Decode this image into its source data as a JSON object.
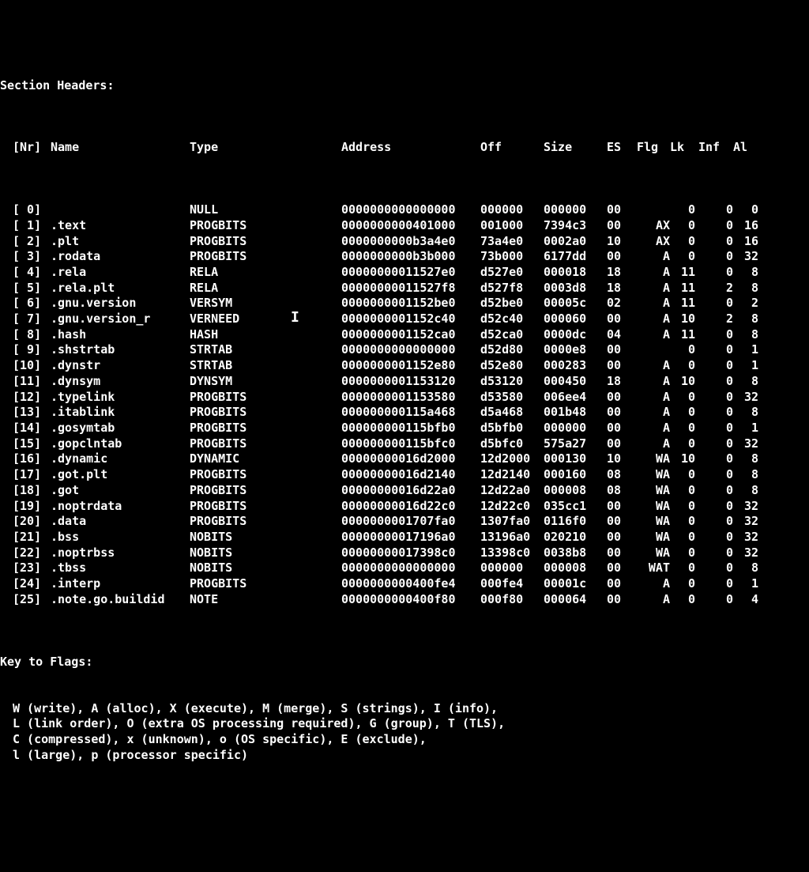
{
  "title": "Section Headers:",
  "header": {
    "nr": "[Nr]",
    "name": "Name",
    "type": "Type",
    "addr": "Address",
    "off": "Off",
    "size": "Size",
    "es": "ES",
    "flg": "Flg",
    "lk": "Lk",
    "inf": "Inf",
    "al": "Al"
  },
  "rows": [
    {
      "nr": "[ 0]",
      "name": "",
      "type": "NULL",
      "addr": "0000000000000000",
      "off": "000000",
      "size": "000000",
      "es": "00",
      "flg": "",
      "lk": "0",
      "inf": "0",
      "al": "0"
    },
    {
      "nr": "[ 1]",
      "name": ".text",
      "type": "PROGBITS",
      "addr": "0000000000401000",
      "off": "001000",
      "size": "7394c3",
      "es": "00",
      "flg": "AX",
      "lk": "0",
      "inf": "0",
      "al": "16"
    },
    {
      "nr": "[ 2]",
      "name": ".plt",
      "type": "PROGBITS",
      "addr": "0000000000b3a4e0",
      "off": "73a4e0",
      "size": "0002a0",
      "es": "10",
      "flg": "AX",
      "lk": "0",
      "inf": "0",
      "al": "16"
    },
    {
      "nr": "[ 3]",
      "name": ".rodata",
      "type": "PROGBITS",
      "addr": "0000000000b3b000",
      "off": "73b000",
      "size": "6177dd",
      "es": "00",
      "flg": "A",
      "lk": "0",
      "inf": "0",
      "al": "32"
    },
    {
      "nr": "[ 4]",
      "name": ".rela",
      "type": "RELA",
      "addr": "00000000011527e0",
      "off": "d527e0",
      "size": "000018",
      "es": "18",
      "flg": "A",
      "lk": "11",
      "inf": "0",
      "al": "8"
    },
    {
      "nr": "[ 5]",
      "name": ".rela.plt",
      "type": "RELA",
      "addr": "00000000011527f8",
      "off": "d527f8",
      "size": "0003d8",
      "es": "18",
      "flg": "A",
      "lk": "11",
      "inf": "2",
      "al": "8"
    },
    {
      "nr": "[ 6]",
      "name": ".gnu.version",
      "type": "VERSYM",
      "addr": "0000000001152be0",
      "off": "d52be0",
      "size": "00005c",
      "es": "02",
      "flg": "A",
      "lk": "11",
      "inf": "0",
      "al": "2"
    },
    {
      "nr": "[ 7]",
      "name": ".gnu.version_r",
      "type": "VERNEED",
      "addr": "0000000001152c40",
      "off": "d52c40",
      "size": "000060",
      "es": "00",
      "flg": "A",
      "lk": "10",
      "inf": "2",
      "al": "8"
    },
    {
      "nr": "[ 8]",
      "name": ".hash",
      "type": "HASH",
      "addr": "0000000001152ca0",
      "off": "d52ca0",
      "size": "0000dc",
      "es": "04",
      "flg": "A",
      "lk": "11",
      "inf": "0",
      "al": "8"
    },
    {
      "nr": "[ 9]",
      "name": ".shstrtab",
      "type": "STRTAB",
      "addr": "0000000000000000",
      "off": "d52d80",
      "size": "0000e8",
      "es": "00",
      "flg": "",
      "lk": "0",
      "inf": "0",
      "al": "1"
    },
    {
      "nr": "[10]",
      "name": ".dynstr",
      "type": "STRTAB",
      "addr": "0000000001152e80",
      "off": "d52e80",
      "size": "000283",
      "es": "00",
      "flg": "A",
      "lk": "0",
      "inf": "0",
      "al": "1"
    },
    {
      "nr": "[11]",
      "name": ".dynsym",
      "type": "DYNSYM",
      "addr": "0000000001153120",
      "off": "d53120",
      "size": "000450",
      "es": "18",
      "flg": "A",
      "lk": "10",
      "inf": "0",
      "al": "8"
    },
    {
      "nr": "[12]",
      "name": ".typelink",
      "type": "PROGBITS",
      "addr": "0000000001153580",
      "off": "d53580",
      "size": "006ee4",
      "es": "00",
      "flg": "A",
      "lk": "0",
      "inf": "0",
      "al": "32"
    },
    {
      "nr": "[13]",
      "name": ".itablink",
      "type": "PROGBITS",
      "addr": "000000000115a468",
      "off": "d5a468",
      "size": "001b48",
      "es": "00",
      "flg": "A",
      "lk": "0",
      "inf": "0",
      "al": "8"
    },
    {
      "nr": "[14]",
      "name": ".gosymtab",
      "type": "PROGBITS",
      "addr": "000000000115bfb0",
      "off": "d5bfb0",
      "size": "000000",
      "es": "00",
      "flg": "A",
      "lk": "0",
      "inf": "0",
      "al": "1"
    },
    {
      "nr": "[15]",
      "name": ".gopclntab",
      "type": "PROGBITS",
      "addr": "000000000115bfc0",
      "off": "d5bfc0",
      "size": "575a27",
      "es": "00",
      "flg": "A",
      "lk": "0",
      "inf": "0",
      "al": "32"
    },
    {
      "nr": "[16]",
      "name": ".dynamic",
      "type": "DYNAMIC",
      "addr": "00000000016d2000",
      "off": "12d2000",
      "size": "000130",
      "es": "10",
      "flg": "WA",
      "lk": "10",
      "inf": "0",
      "al": "8"
    },
    {
      "nr": "[17]",
      "name": ".got.plt",
      "type": "PROGBITS",
      "addr": "00000000016d2140",
      "off": "12d2140",
      "size": "000160",
      "es": "08",
      "flg": "WA",
      "lk": "0",
      "inf": "0",
      "al": "8"
    },
    {
      "nr": "[18]",
      "name": ".got",
      "type": "PROGBITS",
      "addr": "00000000016d22a0",
      "off": "12d22a0",
      "size": "000008",
      "es": "08",
      "flg": "WA",
      "lk": "0",
      "inf": "0",
      "al": "8"
    },
    {
      "nr": "[19]",
      "name": ".noptrdata",
      "type": "PROGBITS",
      "addr": "00000000016d22c0",
      "off": "12d22c0",
      "size": "035cc1",
      "es": "00",
      "flg": "WA",
      "lk": "0",
      "inf": "0",
      "al": "32"
    },
    {
      "nr": "[20]",
      "name": ".data",
      "type": "PROGBITS",
      "addr": "0000000001707fa0",
      "off": "1307fa0",
      "size": "0116f0",
      "es": "00",
      "flg": "WA",
      "lk": "0",
      "inf": "0",
      "al": "32"
    },
    {
      "nr": "[21]",
      "name": ".bss",
      "type": "NOBITS",
      "addr": "00000000017196a0",
      "off": "13196a0",
      "size": "020210",
      "es": "00",
      "flg": "WA",
      "lk": "0",
      "inf": "0",
      "al": "32"
    },
    {
      "nr": "[22]",
      "name": ".noptrbss",
      "type": "NOBITS",
      "addr": "00000000017398c0",
      "off": "13398c0",
      "size": "0038b8",
      "es": "00",
      "flg": "WA",
      "lk": "0",
      "inf": "0",
      "al": "32"
    },
    {
      "nr": "[23]",
      "name": ".tbss",
      "type": "NOBITS",
      "addr": "0000000000000000",
      "off": "000000",
      "size": "000008",
      "es": "00",
      "flg": "WAT",
      "lk": "0",
      "inf": "0",
      "al": "8"
    },
    {
      "nr": "[24]",
      "name": ".interp",
      "type": "PROGBITS",
      "addr": "0000000000400fe4",
      "off": "000fe4",
      "size": "00001c",
      "es": "00",
      "flg": "A",
      "lk": "0",
      "inf": "0",
      "al": "1"
    },
    {
      "nr": "[25]",
      "name": ".note.go.buildid",
      "type": "NOTE",
      "addr": "0000000000400f80",
      "off": "000f80",
      "size": "000064",
      "es": "00",
      "flg": "A",
      "lk": "0",
      "inf": "0",
      "al": "4"
    }
  ],
  "keyTitle": "Key to Flags:",
  "keys": [
    "W (write), A (alloc), X (execute), M (merge), S (strings), I (info),",
    "L (link order), O (extra OS processing required), G (group), T (TLS),",
    "C (compressed), x (unknown), o (OS specific), E (exclude),",
    "l (large), p (processor specific)"
  ],
  "cursor": "I"
}
